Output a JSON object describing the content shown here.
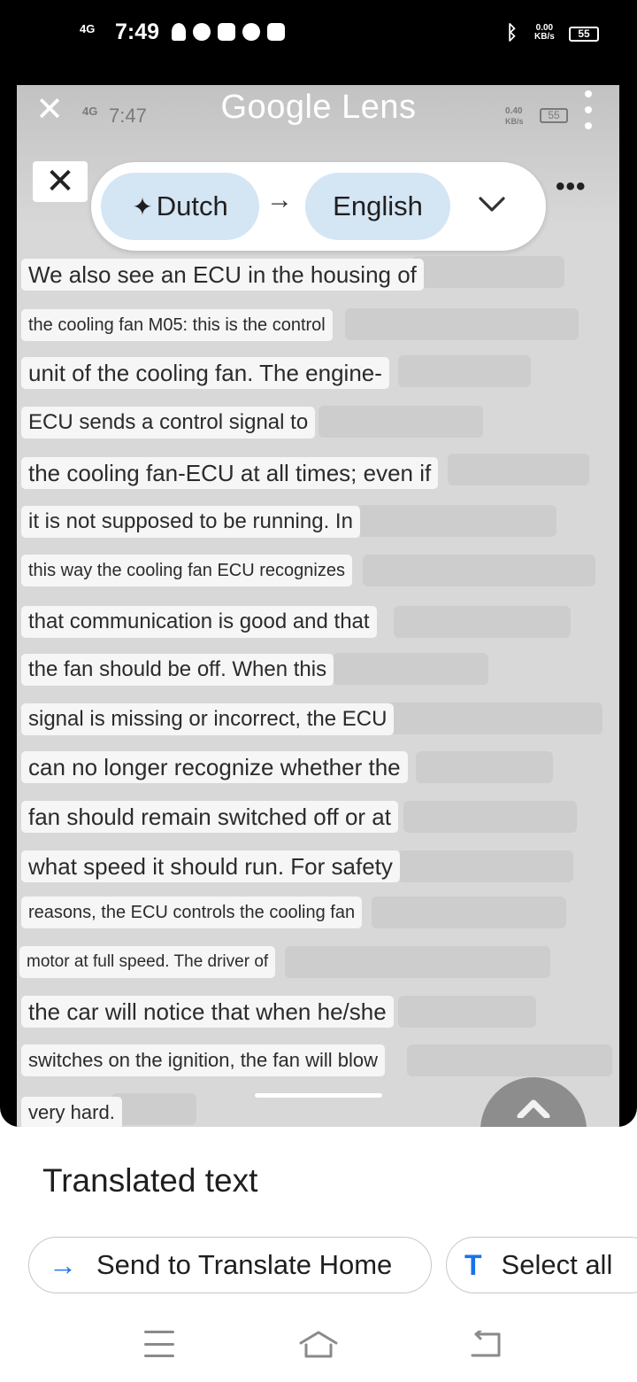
{
  "status_bar": {
    "network": "4G",
    "time": "7:49",
    "speed_value": "0.00",
    "speed_unit": "KB/s",
    "battery": "55"
  },
  "screenshot_status": {
    "network": "4G",
    "time": "7:47",
    "speed_value": "0.40",
    "speed_unit": "KB/s",
    "battery": "55"
  },
  "lens": {
    "title": "Google Lens",
    "source_language": "Dutch",
    "target_language": "English",
    "arrow": "→"
  },
  "translated_lines": [
    "We also see an ECU in the housing of",
    "the cooling fan M05: this is the control",
    "unit of the cooling fan. The engine-",
    "ECU sends a control signal to",
    "the cooling fan-ECU at all times; even if",
    "it is not supposed to be running. In",
    "this way the cooling fan ECU recognizes",
    "that communication is good and that",
    "the fan should be off. When this",
    "signal is missing or incorrect, the ECU",
    "can no longer recognize whether the",
    "fan should remain switched off or at",
    "what speed it should run. For safety",
    "reasons, the ECU controls the cooling fan",
    "motor at full speed. The driver of",
    "the car will notice that when he/she",
    "switches on the ignition, the fan will blow",
    "very hard."
  ],
  "bottom_sheet": {
    "title": "Translated text",
    "send_button": "Send to Translate Home",
    "select_all_button": "Select all"
  },
  "icons": {
    "send_icon": "→",
    "select_icon": "T"
  }
}
